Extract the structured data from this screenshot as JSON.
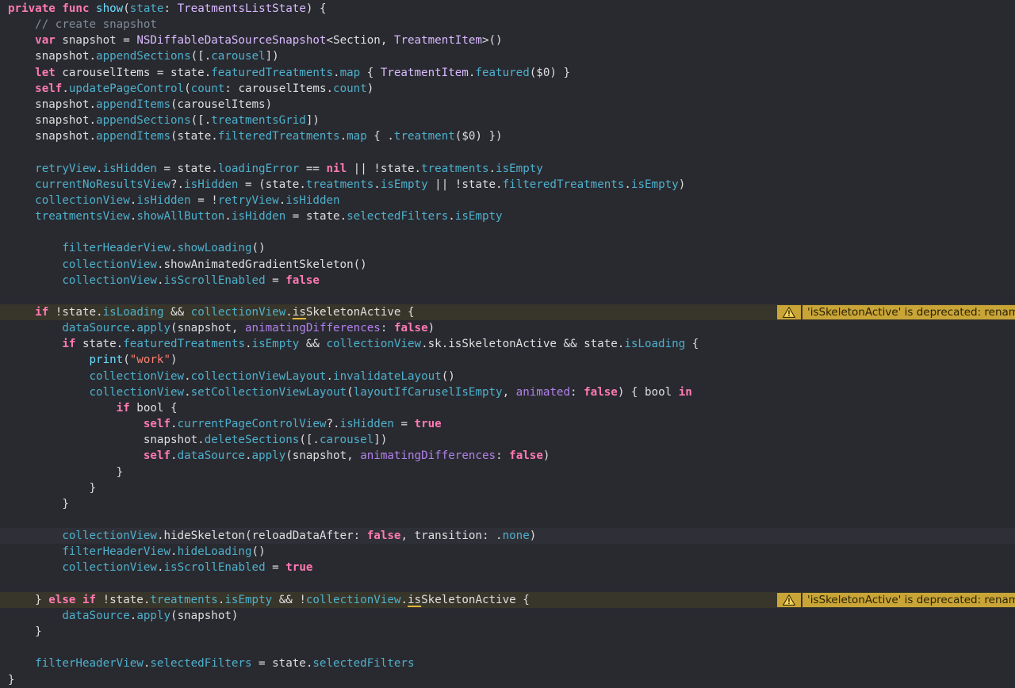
{
  "colors": {
    "background": "#292a30",
    "keyword": "#ff7ab2",
    "function": "#6bdfff",
    "type": "#dabaff",
    "property": "#4eb0cc",
    "comment": "#7f8c98",
    "string": "#ff8170",
    "warning_banner": "#c9a538"
  },
  "warning_message": "'isSkeletonActive' is deprecated: renam",
  "lines": [
    {
      "bg": "",
      "tokens": [
        [
          "kw",
          "private func "
        ],
        [
          "fn",
          "show"
        ],
        [
          "pl",
          "("
        ],
        [
          "prop",
          "state"
        ],
        [
          "pl",
          ": "
        ],
        [
          "ty",
          "TreatmentsListState"
        ],
        [
          "pl",
          ") {"
        ]
      ]
    },
    {
      "bg": "",
      "tokens": [
        [
          "pl",
          "    "
        ],
        [
          "cm",
          "// create snapshot"
        ]
      ]
    },
    {
      "bg": "",
      "tokens": [
        [
          "pl",
          "    "
        ],
        [
          "kw",
          "var "
        ],
        [
          "pl",
          "snapshot = "
        ],
        [
          "ty",
          "NSDiffableDataSourceSnapshot"
        ],
        [
          "pl",
          "<Section, "
        ],
        [
          "ty",
          "TreatmentItem"
        ],
        [
          "pl",
          ">()"
        ]
      ]
    },
    {
      "bg": "",
      "tokens": [
        [
          "pl",
          "    snapshot."
        ],
        [
          "prop",
          "appendSections"
        ],
        [
          "pl",
          "([."
        ],
        [
          "prop",
          "carousel"
        ],
        [
          "pl",
          "])"
        ]
      ]
    },
    {
      "bg": "",
      "tokens": [
        [
          "pl",
          "    "
        ],
        [
          "kw",
          "let "
        ],
        [
          "pl",
          "carouselItems = state."
        ],
        [
          "prop",
          "featuredTreatments"
        ],
        [
          "pl",
          "."
        ],
        [
          "prop",
          "map"
        ],
        [
          "pl",
          " { "
        ],
        [
          "ty",
          "TreatmentItem"
        ],
        [
          "pl",
          "."
        ],
        [
          "prop",
          "featured"
        ],
        [
          "pl",
          "($0) }"
        ]
      ]
    },
    {
      "bg": "",
      "tokens": [
        [
          "pl",
          "    "
        ],
        [
          "kw",
          "self"
        ],
        [
          "pl",
          "."
        ],
        [
          "prop",
          "updatePageControl"
        ],
        [
          "pl",
          "("
        ],
        [
          "prop",
          "count"
        ],
        [
          "pl",
          ": carouselItems."
        ],
        [
          "prop",
          "count"
        ],
        [
          "pl",
          ")"
        ]
      ]
    },
    {
      "bg": "",
      "tokens": [
        [
          "pl",
          "    snapshot."
        ],
        [
          "prop",
          "appendItems"
        ],
        [
          "pl",
          "(carouselItems)"
        ]
      ]
    },
    {
      "bg": "",
      "tokens": [
        [
          "pl",
          "    snapshot."
        ],
        [
          "prop",
          "appendSections"
        ],
        [
          "pl",
          "([."
        ],
        [
          "prop",
          "treatmentsGrid"
        ],
        [
          "pl",
          "])"
        ]
      ]
    },
    {
      "bg": "",
      "tokens": [
        [
          "pl",
          "    snapshot."
        ],
        [
          "prop",
          "appendItems"
        ],
        [
          "pl",
          "(state."
        ],
        [
          "prop",
          "filteredTreatments"
        ],
        [
          "pl",
          "."
        ],
        [
          "prop",
          "map"
        ],
        [
          "pl",
          " { ."
        ],
        [
          "prop",
          "treatment"
        ],
        [
          "pl",
          "($0) })"
        ]
      ]
    },
    {
      "bg": "",
      "tokens": []
    },
    {
      "bg": "",
      "tokens": [
        [
          "pl",
          "    "
        ],
        [
          "prop",
          "retryView"
        ],
        [
          "pl",
          "."
        ],
        [
          "prop",
          "isHidden"
        ],
        [
          "pl",
          " = state."
        ],
        [
          "prop",
          "loadingError"
        ],
        [
          "pl",
          " == "
        ],
        [
          "kw",
          "nil"
        ],
        [
          "pl",
          " || !state."
        ],
        [
          "prop",
          "treatments"
        ],
        [
          "pl",
          "."
        ],
        [
          "prop",
          "isEmpty"
        ]
      ]
    },
    {
      "bg": "",
      "tokens": [
        [
          "pl",
          "    "
        ],
        [
          "prop",
          "currentNoResultsView"
        ],
        [
          "pl",
          "?."
        ],
        [
          "prop",
          "isHidden"
        ],
        [
          "pl",
          " = (state."
        ],
        [
          "prop",
          "treatments"
        ],
        [
          "pl",
          "."
        ],
        [
          "prop",
          "isEmpty"
        ],
        [
          "pl",
          " || !state."
        ],
        [
          "prop",
          "filteredTreatments"
        ],
        [
          "pl",
          "."
        ],
        [
          "prop",
          "isEmpty"
        ],
        [
          "pl",
          ")"
        ]
      ]
    },
    {
      "bg": "",
      "tokens": [
        [
          "pl",
          "    "
        ],
        [
          "prop",
          "collectionView"
        ],
        [
          "pl",
          "."
        ],
        [
          "prop",
          "isHidden"
        ],
        [
          "pl",
          " = !"
        ],
        [
          "prop",
          "retryView"
        ],
        [
          "pl",
          "."
        ],
        [
          "prop",
          "isHidden"
        ]
      ]
    },
    {
      "bg": "",
      "tokens": [
        [
          "pl",
          "    "
        ],
        [
          "prop",
          "treatmentsView"
        ],
        [
          "pl",
          "."
        ],
        [
          "prop",
          "showAllButton"
        ],
        [
          "pl",
          "."
        ],
        [
          "prop",
          "isHidden"
        ],
        [
          "pl",
          " = state."
        ],
        [
          "prop",
          "selectedFilters"
        ],
        [
          "pl",
          "."
        ],
        [
          "prop",
          "isEmpty"
        ]
      ]
    },
    {
      "bg": "",
      "tokens": []
    },
    {
      "bg": "",
      "tokens": [
        [
          "pl",
          "        "
        ],
        [
          "prop",
          "filterHeaderView"
        ],
        [
          "pl",
          "."
        ],
        [
          "prop",
          "showLoading"
        ],
        [
          "pl",
          "()"
        ]
      ]
    },
    {
      "bg": "",
      "tokens": [
        [
          "pl",
          "        "
        ],
        [
          "prop",
          "collectionView"
        ],
        [
          "pl",
          ".showAnimatedGradientSkeleton()"
        ]
      ]
    },
    {
      "bg": "",
      "tokens": [
        [
          "pl",
          "        "
        ],
        [
          "prop",
          "collectionView"
        ],
        [
          "pl",
          "."
        ],
        [
          "prop",
          "isScrollEnabled"
        ],
        [
          "pl",
          " = "
        ],
        [
          "kw",
          "false"
        ]
      ]
    },
    {
      "bg": "",
      "tokens": []
    },
    {
      "bg": "warn",
      "tokens": [
        [
          "pl",
          "    "
        ],
        [
          "kw",
          "if"
        ],
        [
          "pl",
          " !state."
        ],
        [
          "prop",
          "isLoading"
        ],
        [
          "pl",
          " && "
        ],
        [
          "prop",
          "collectionView"
        ],
        [
          "pl",
          "."
        ],
        [
          "ul",
          "is"
        ],
        [
          "pl",
          "SkeletonActive {"
        ]
      ]
    },
    {
      "bg": "",
      "tokens": [
        [
          "pl",
          "        "
        ],
        [
          "prop",
          "dataSource"
        ],
        [
          "pl",
          "."
        ],
        [
          "prop",
          "apply"
        ],
        [
          "pl",
          "(snapshot, "
        ],
        [
          "tyi",
          "animatingDifferences"
        ],
        [
          "pl",
          ": "
        ],
        [
          "kw",
          "false"
        ],
        [
          "pl",
          ")"
        ]
      ]
    },
    {
      "bg": "",
      "tokens": [
        [
          "pl",
          "        "
        ],
        [
          "kw",
          "if"
        ],
        [
          "pl",
          " state."
        ],
        [
          "prop",
          "featuredTreatments"
        ],
        [
          "pl",
          "."
        ],
        [
          "prop",
          "isEmpty"
        ],
        [
          "pl",
          " && "
        ],
        [
          "prop",
          "collectionView"
        ],
        [
          "pl",
          ".sk.isSkeletonActive && state."
        ],
        [
          "prop",
          "isLoading"
        ],
        [
          "pl",
          " {"
        ]
      ]
    },
    {
      "bg": "",
      "tokens": [
        [
          "pl",
          "            "
        ],
        [
          "fn",
          "print"
        ],
        [
          "pl",
          "("
        ],
        [
          "str",
          "\"work\""
        ],
        [
          "pl",
          ")"
        ]
      ]
    },
    {
      "bg": "",
      "tokens": [
        [
          "pl",
          "            "
        ],
        [
          "prop",
          "collectionView"
        ],
        [
          "pl",
          "."
        ],
        [
          "prop",
          "collectionViewLayout"
        ],
        [
          "pl",
          "."
        ],
        [
          "prop",
          "invalidateLayout"
        ],
        [
          "pl",
          "()"
        ]
      ]
    },
    {
      "bg": "",
      "tokens": [
        [
          "pl",
          "            "
        ],
        [
          "prop",
          "collectionView"
        ],
        [
          "pl",
          "."
        ],
        [
          "prop",
          "setCollectionViewLayout"
        ],
        [
          "pl",
          "("
        ],
        [
          "prop",
          "layoutIfCaruselIsEmpty"
        ],
        [
          "pl",
          ", "
        ],
        [
          "tyi",
          "animated"
        ],
        [
          "pl",
          ": "
        ],
        [
          "kw",
          "false"
        ],
        [
          "pl",
          ") { bool "
        ],
        [
          "kw",
          "in"
        ]
      ]
    },
    {
      "bg": "",
      "tokens": [
        [
          "pl",
          "                "
        ],
        [
          "kw",
          "if"
        ],
        [
          "pl",
          " bool {"
        ]
      ]
    },
    {
      "bg": "",
      "tokens": [
        [
          "pl",
          "                    "
        ],
        [
          "kw",
          "self"
        ],
        [
          "pl",
          "."
        ],
        [
          "prop",
          "currentPageControlView"
        ],
        [
          "pl",
          "?."
        ],
        [
          "prop",
          "isHidden"
        ],
        [
          "pl",
          " = "
        ],
        [
          "kw",
          "true"
        ]
      ]
    },
    {
      "bg": "",
      "tokens": [
        [
          "pl",
          "                    snapshot."
        ],
        [
          "prop",
          "deleteSections"
        ],
        [
          "pl",
          "([."
        ],
        [
          "prop",
          "carousel"
        ],
        [
          "pl",
          "])"
        ]
      ]
    },
    {
      "bg": "",
      "tokens": [
        [
          "pl",
          "                    "
        ],
        [
          "kw",
          "self"
        ],
        [
          "pl",
          "."
        ],
        [
          "prop",
          "dataSource"
        ],
        [
          "pl",
          "."
        ],
        [
          "prop",
          "apply"
        ],
        [
          "pl",
          "(snapshot, "
        ],
        [
          "tyi",
          "animatingDifferences"
        ],
        [
          "pl",
          ": "
        ],
        [
          "kw",
          "false"
        ],
        [
          "pl",
          ")"
        ]
      ]
    },
    {
      "bg": "",
      "tokens": [
        [
          "pl",
          "                }"
        ]
      ]
    },
    {
      "bg": "",
      "tokens": [
        [
          "pl",
          "            }"
        ]
      ]
    },
    {
      "bg": "",
      "tokens": [
        [
          "pl",
          "        }"
        ]
      ]
    },
    {
      "bg": "",
      "tokens": []
    },
    {
      "bg": "cursor",
      "tokens": [
        [
          "pl",
          "        "
        ],
        [
          "prop",
          "collectionView"
        ],
        [
          "pl",
          ".hideSkeleton(reloadDataAfter: "
        ],
        [
          "kw",
          "false"
        ],
        [
          "pl",
          ", transition: ."
        ],
        [
          "prop",
          "none"
        ],
        [
          "pl",
          ")"
        ]
      ]
    },
    {
      "bg": "",
      "tokens": [
        [
          "pl",
          "        "
        ],
        [
          "prop",
          "filterHeaderView"
        ],
        [
          "pl",
          "."
        ],
        [
          "prop",
          "hideLoading"
        ],
        [
          "pl",
          "()"
        ]
      ]
    },
    {
      "bg": "",
      "tokens": [
        [
          "pl",
          "        "
        ],
        [
          "prop",
          "collectionView"
        ],
        [
          "pl",
          "."
        ],
        [
          "prop",
          "isScrollEnabled"
        ],
        [
          "pl",
          " = "
        ],
        [
          "kw",
          "true"
        ]
      ]
    },
    {
      "bg": "",
      "tokens": []
    },
    {
      "bg": "warn",
      "tokens": [
        [
          "pl",
          "    } "
        ],
        [
          "kw",
          "else if"
        ],
        [
          "pl",
          " !state."
        ],
        [
          "prop",
          "treatments"
        ],
        [
          "pl",
          "."
        ],
        [
          "prop",
          "isEmpty"
        ],
        [
          "pl",
          " && !"
        ],
        [
          "prop",
          "collectionView"
        ],
        [
          "pl",
          "."
        ],
        [
          "ul",
          "is"
        ],
        [
          "pl",
          "SkeletonActive {"
        ]
      ]
    },
    {
      "bg": "",
      "tokens": [
        [
          "pl",
          "        "
        ],
        [
          "prop",
          "dataSource"
        ],
        [
          "pl",
          "."
        ],
        [
          "prop",
          "apply"
        ],
        [
          "pl",
          "(snapshot)"
        ]
      ]
    },
    {
      "bg": "",
      "tokens": [
        [
          "pl",
          "    }"
        ]
      ]
    },
    {
      "bg": "",
      "tokens": []
    },
    {
      "bg": "",
      "tokens": [
        [
          "pl",
          "    "
        ],
        [
          "prop",
          "filterHeaderView"
        ],
        [
          "pl",
          "."
        ],
        [
          "prop",
          "selectedFilters"
        ],
        [
          "pl",
          " = state."
        ],
        [
          "prop",
          "selectedFilters"
        ]
      ]
    },
    {
      "bg": "",
      "tokens": [
        [
          "pl",
          "}"
        ]
      ]
    }
  ]
}
